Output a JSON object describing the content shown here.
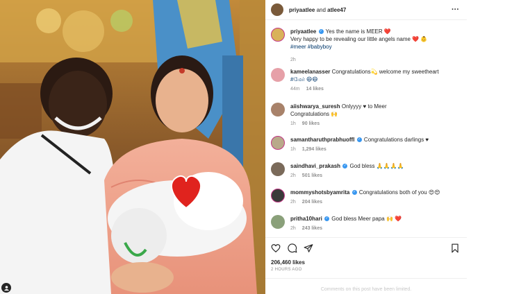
{
  "post": {
    "header_user1": "priyaatlee",
    "header_and": " and ",
    "header_user2": "atlee47",
    "more_icon": "ellipsis-icon",
    "caption": {
      "user": "priyaatlee",
      "line1": "Yes the name is MEER ❤️",
      "line2": "Very happy to be revealing our little angels name ❤️ 👶",
      "hashtags": "#meer #babyboy",
      "time": "2h"
    },
    "comments": [
      {
        "user": "kameelanasser",
        "verified": false,
        "text": "Congratulations💫  welcome my sweetheart",
        "text2": "#மேர் 😄😄",
        "time": "44m",
        "likes": "14 likes"
      },
      {
        "user": "aiishwarya_suresh",
        "verified": false,
        "text": "Onlyyyy ♥ to Meer",
        "text2": "Congratulations 🙌",
        "time": "1h",
        "likes": "90 likes"
      },
      {
        "user": "samantharuthprabhuoffl",
        "verified": true,
        "text": "Congratulations darlings ♥",
        "text2": "",
        "time": "1h",
        "likes": "1,294 likes"
      },
      {
        "user": "saindhavi_prakash",
        "verified": true,
        "text": "God bless 🙏🙏🙏🙏",
        "text2": "",
        "time": "2h",
        "likes": "501 likes"
      },
      {
        "user": "mommyshotsbyamrita",
        "verified": true,
        "text": "Congratulations both of you 😍😍",
        "text2": "",
        "time": "2h",
        "likes": "204 likes"
      },
      {
        "user": "pritha10hari",
        "verified": true,
        "text": "God bless Meer papa 🙌 ❤️",
        "text2": "",
        "time": "2h",
        "likes": "243 likes"
      }
    ],
    "like_count": "206,460 likes",
    "post_time": "2 HOURS AGO",
    "limited_notice": "Comments on this post have been limited."
  },
  "icons": {
    "like": "heart-icon",
    "comment": "comment-icon",
    "share": "share-icon",
    "save": "bookmark-icon"
  },
  "colors": {
    "verified": "#3897f0",
    "hashtag": "#00376b",
    "muted": "#8e8e8e"
  }
}
